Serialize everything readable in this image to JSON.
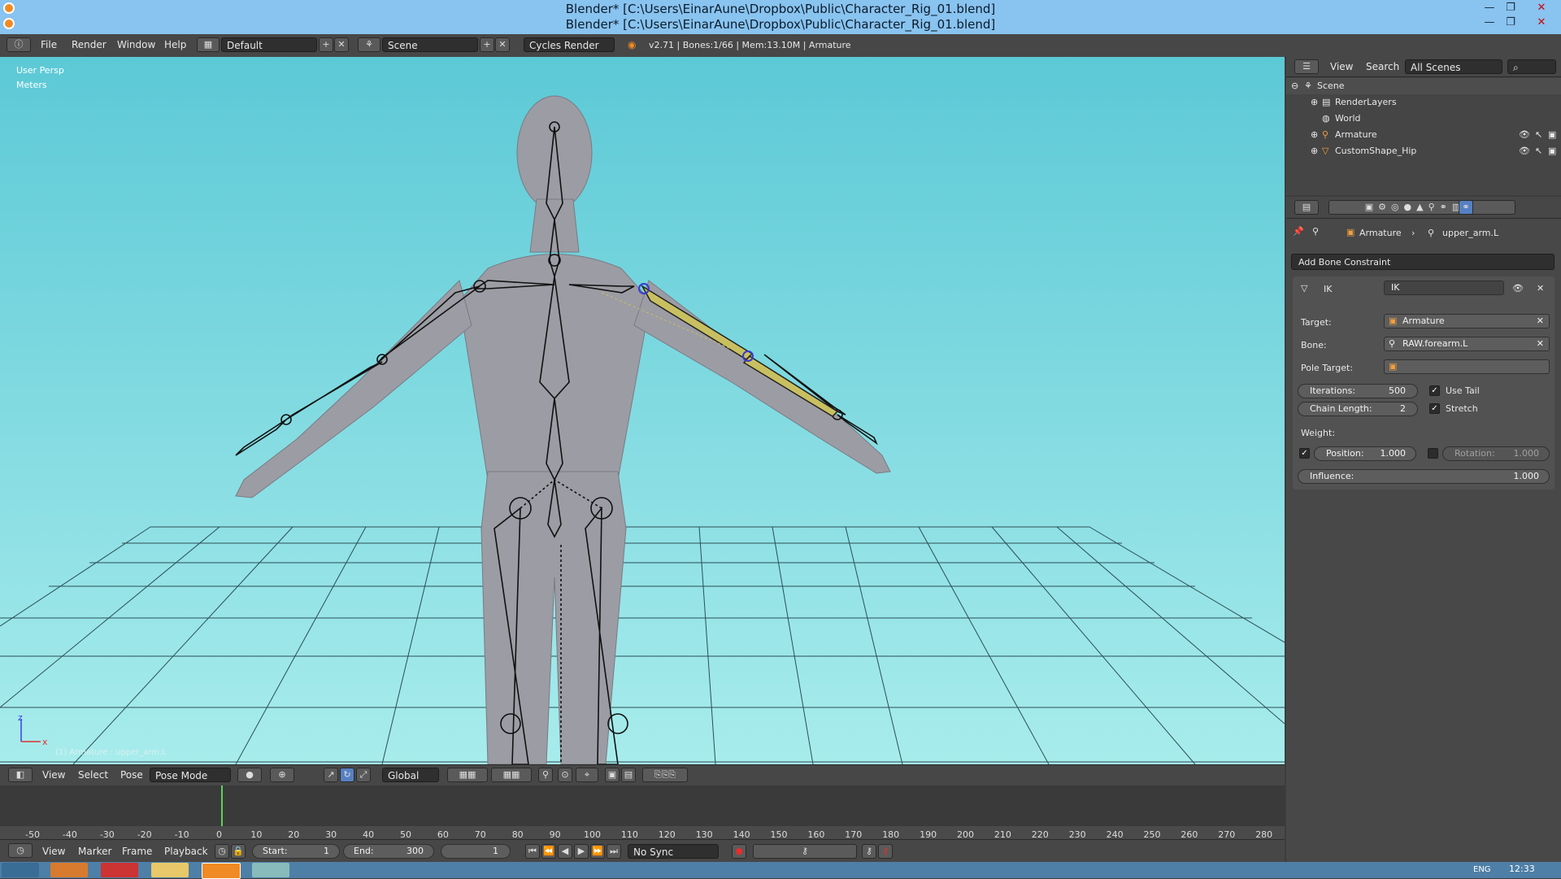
{
  "window": {
    "title": "Blender* [C:\\Users\\EinarAune\\Dropbox\\Public\\Character_Rig_01.blend]"
  },
  "menus": [
    "File",
    "Render",
    "Window",
    "Help"
  ],
  "header": {
    "layout": "Default",
    "scene": "Scene",
    "engine": "Cycles Render",
    "stats": "v2.71 | Bones:1/66 | Mem:13.10M | Armature"
  },
  "viewport": {
    "view_name": "User Persp",
    "units": "Meters",
    "axis_x": "x",
    "axis_z": "z",
    "selection_info": "(1) Armature : upper_arm.L",
    "menus": [
      "View",
      "Select",
      "Pose"
    ],
    "mode": "Pose Mode",
    "orientation": "Global"
  },
  "timeline": {
    "ticks": [
      "-50",
      "-40",
      "-30",
      "-20",
      "-10",
      "0",
      "10",
      "20",
      "30",
      "40",
      "50",
      "60",
      "70",
      "80",
      "90",
      "100",
      "110",
      "120",
      "130",
      "140",
      "150",
      "160",
      "170",
      "180",
      "190",
      "200",
      "210",
      "220",
      "230",
      "240",
      "250",
      "260",
      "270",
      "280"
    ],
    "menus": [
      "View",
      "Marker",
      "Frame",
      "Playback"
    ],
    "start_label": "Start:",
    "start": "1",
    "end_label": "End:",
    "end": "300",
    "current": "1",
    "sync": "No Sync"
  },
  "outliner": {
    "menus": [
      "View",
      "Search"
    ],
    "filter": "All Scenes",
    "items": [
      {
        "label": "Scene",
        "indent": 0
      },
      {
        "label": "RenderLayers",
        "indent": 1
      },
      {
        "label": "World",
        "indent": 1
      },
      {
        "label": "Armature",
        "indent": 1
      },
      {
        "label": "CustomShape_Hip",
        "indent": 1
      }
    ]
  },
  "properties": {
    "breadcrumb_object": "Armature",
    "breadcrumb_bone": "upper_arm.L",
    "add_constraint": "Add Bone Constraint",
    "constraint_type": "IK",
    "constraint_name": "IK",
    "target_label": "Target:",
    "target": "Armature",
    "bone_label": "Bone:",
    "bone": "RAW.forearm.L",
    "pole_label": "Pole Target:",
    "iterations_label": "Iterations:",
    "iterations": "500",
    "use_tail": "Use Tail",
    "chain_label": "Chain Length:",
    "chain": "2",
    "stretch": "Stretch",
    "weight_label": "Weight:",
    "position_label": "Position:",
    "position": "1.000",
    "rotation_label": "Rotation:",
    "rotation": "1.000",
    "influence_label": "Influence:",
    "influence": "1.000"
  },
  "taskbar": {
    "time": "12:33",
    "lang": "ENG"
  },
  "colors": {
    "accent": "#5680c2",
    "viewport_top": "#5cc9d6",
    "viewport_bottom": "#a8ecec",
    "selected_bone": "#c8c060"
  }
}
